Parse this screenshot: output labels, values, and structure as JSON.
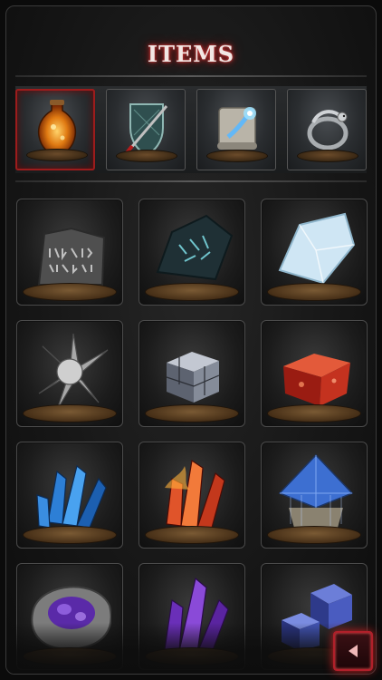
{
  "header": {
    "title": "ITEMS"
  },
  "tabs": [
    {
      "icon": "estus-flask-icon",
      "active": true
    },
    {
      "icon": "shield-icon",
      "active": false
    },
    {
      "icon": "scroll-icon",
      "active": false
    },
    {
      "icon": "serpent-ring-icon",
      "active": false
    }
  ],
  "items": [
    {
      "icon": "rune-stone-icon"
    },
    {
      "icon": "dark-rune-shard-icon"
    },
    {
      "icon": "frost-crystal-icon"
    },
    {
      "icon": "silver-shard-cluster-icon"
    },
    {
      "icon": "steel-cube-icon"
    },
    {
      "icon": "red-ember-cube-icon"
    },
    {
      "icon": "blue-crystal-cluster-icon"
    },
    {
      "icon": "fire-crystal-cluster-icon"
    },
    {
      "icon": "sapphire-pyramid-icon"
    },
    {
      "icon": "purple-geode-icon"
    },
    {
      "icon": "amethyst-cluster-icon"
    },
    {
      "icon": "indigo-cube-cluster-icon"
    }
  ],
  "navigation": {
    "back_icon": "triangle-left-icon"
  }
}
